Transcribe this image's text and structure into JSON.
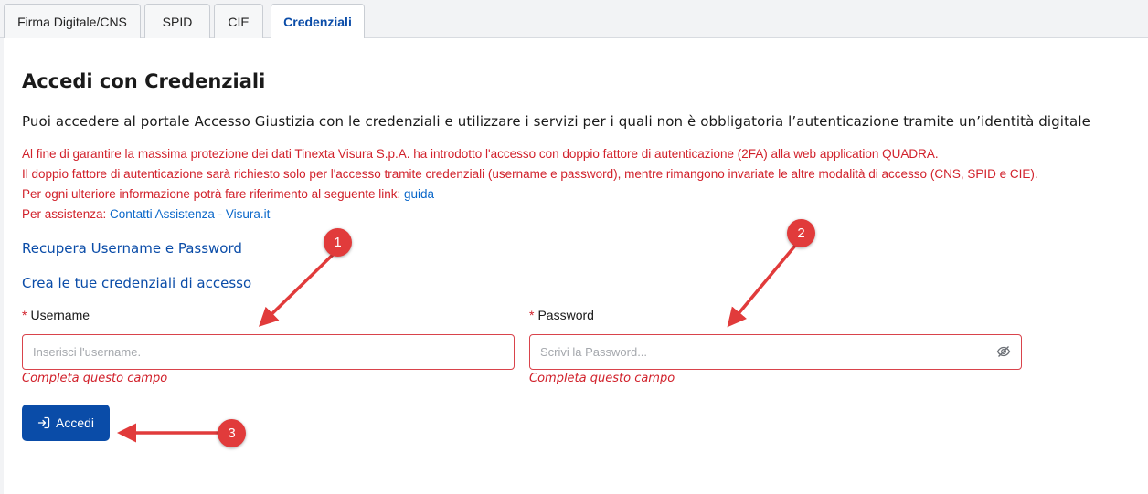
{
  "tabs": [
    {
      "label": "Firma Digitale/CNS",
      "active": false
    },
    {
      "label": "SPID",
      "active": false
    },
    {
      "label": "CIE",
      "active": false
    },
    {
      "label": "Credenziali",
      "active": true
    }
  ],
  "main": {
    "title": "Accedi con Credenziali",
    "subtitle": "Puoi accedere al portale Accesso Giustizia con le credenziali e utilizzare i servizi per i quali non è obbligatoria l’autenticazione tramite un’identità digitale",
    "notice": {
      "line1": "Al fine di garantire la massima protezione dei dati Tinexta Visura S.p.A. ha introdotto l'accesso con doppio fattore di autenticazione (2FA) alla web application QUADRA.",
      "line2": "Il doppio fattore di autenticazione sarà richiesto solo per l'accesso tramite credenziali (username e password), mentre rimangono invariate le altre modalità di accesso (CNS, SPID e CIE).",
      "line3_text": "Per ogni ulteriore informazione potrà fare riferimento al seguente link: ",
      "line3_link": "guida",
      "line4_text": "Per assistenza: ",
      "line4_link": "Contatti Assistenza - Visura.it"
    },
    "recover_link": "Recupera Username e Password",
    "create_link": "Crea le tue credenziali di accesso"
  },
  "form": {
    "required_marker": "*",
    "username": {
      "label": "Username",
      "value": "",
      "placeholder": "Inserisci l'username.",
      "error": "Completa questo campo"
    },
    "password": {
      "label": "Password",
      "value": "",
      "placeholder": "Scrivi la Password...",
      "error": "Completa questo campo",
      "toggle_icon": "eye-off-icon"
    },
    "submit": {
      "label": "Accedi",
      "icon": "login-icon"
    }
  },
  "annotations": {
    "badge1": "1",
    "badge2": "2",
    "badge3": "3",
    "color": "#e13b3b"
  },
  "colors": {
    "accent": "#0a4ca8",
    "error": "#d1212b",
    "link": "#0a67c9"
  }
}
